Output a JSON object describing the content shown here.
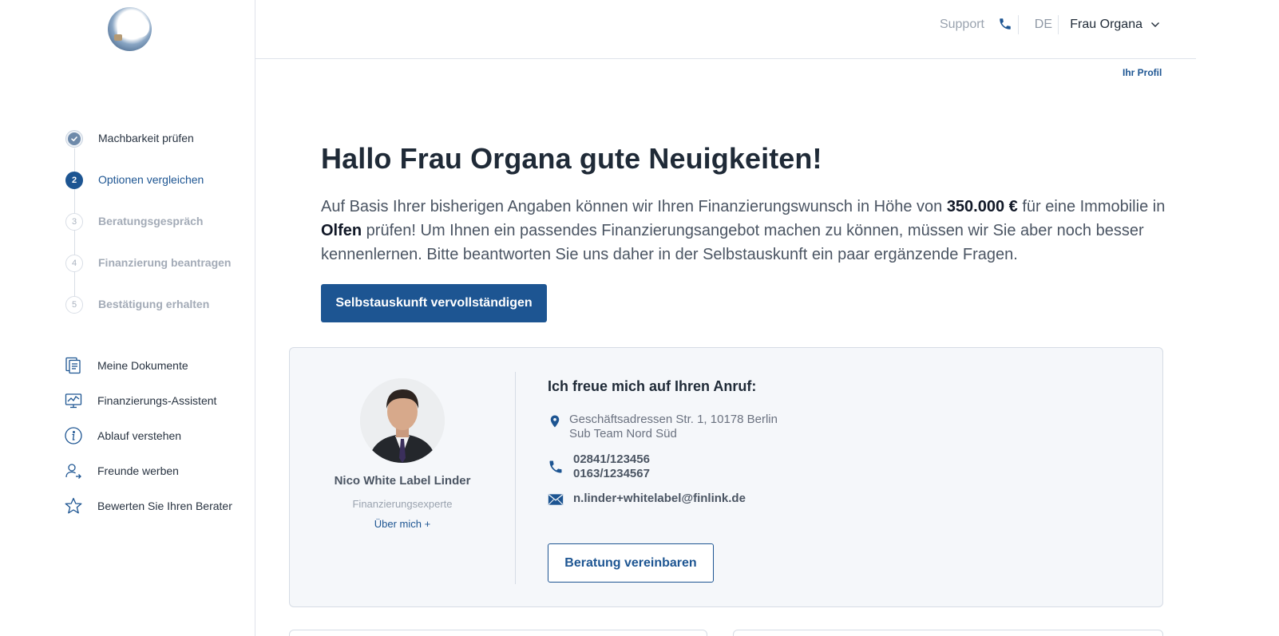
{
  "header": {
    "support_label": "Support",
    "language": "DE",
    "user_name": "Frau Organa",
    "profile_link": "Ihr Profil"
  },
  "steps": [
    {
      "number": "",
      "label": "Machbarkeit prüfen",
      "state": "done"
    },
    {
      "number": "2",
      "label": "Optionen vergleichen",
      "state": "active"
    },
    {
      "number": "3",
      "label": "Beratungsgespräch",
      "state": "pending"
    },
    {
      "number": "4",
      "label": "Finanzierung beantragen",
      "state": "pending"
    },
    {
      "number": "5",
      "label": "Bestätigung erhalten",
      "state": "pending"
    }
  ],
  "menu": [
    {
      "icon": "documents-icon",
      "label": "Meine Dokumente"
    },
    {
      "icon": "chart-monitor-icon",
      "label": "Finanzierungs-Assistent"
    },
    {
      "icon": "info-icon",
      "label": "Ablauf verstehen"
    },
    {
      "icon": "user-add-icon",
      "label": "Freunde werben"
    },
    {
      "icon": "star-icon",
      "label": "Bewerten Sie Ihren Berater"
    }
  ],
  "main": {
    "title": "Hallo Frau Organa gute Neuigkeiten!",
    "intro_part1": "Auf Basis Ihrer bisherigen Angaben können wir Ihren Finanzierungswunsch in Höhe von ",
    "intro_amount": "350.000 €",
    "intro_part2": " für eine Immobilie in ",
    "intro_city": "Olfen",
    "intro_part3": " prüfen! Um Ihnen ein passendes Finanzierungsangebot machen zu können, müssen wir Sie aber noch besser kennenlernen. Bitte beantworten Sie uns daher in der Selbstauskunft ein paar ergänzende Fragen.",
    "cta_label": "Selbstauskunft vervollständigen"
  },
  "advisor": {
    "name": "Nico White Label Linder",
    "role": "Finanzierungsexperte",
    "more_link": "Über mich +",
    "call_title": "Ich freue mich auf Ihren Anruf:",
    "address_line1": "Geschäftsadressen Str. 1, 10178 Berlin",
    "address_line2": "Sub Team Nord Süd",
    "phone1": "02841/123456",
    "phone2": "0163/1234567",
    "email": "n.linder+whitelabel@finlink.de",
    "appointment_button": "Beratung vereinbaren"
  },
  "colors": {
    "primary": "#1d5592",
    "card_bg": "#f5f7fa"
  }
}
